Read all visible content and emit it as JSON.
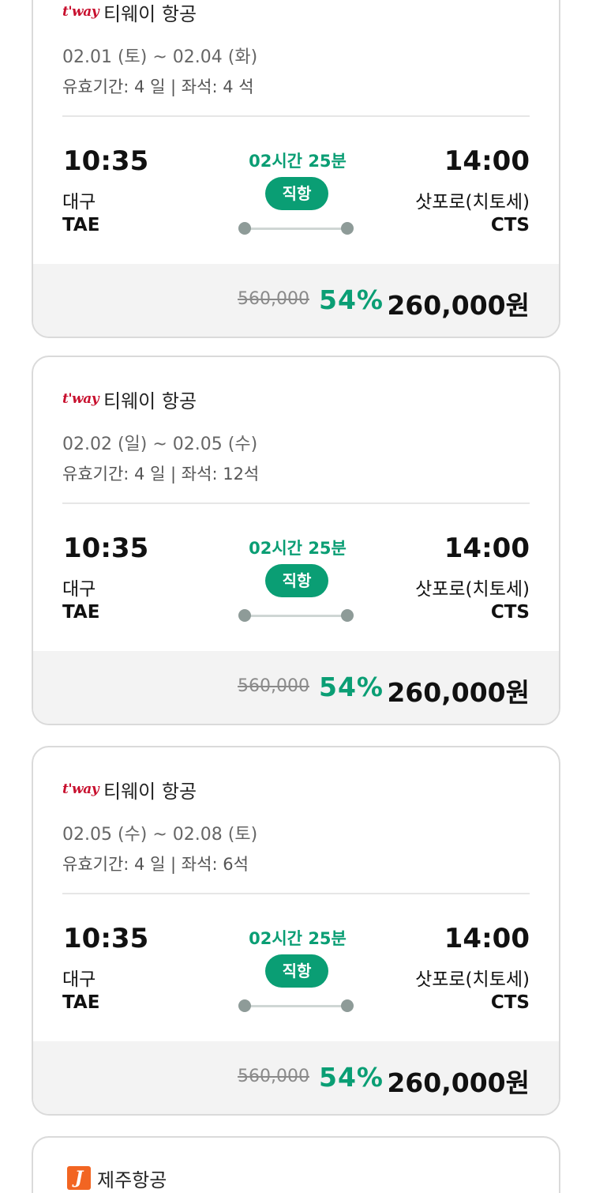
{
  "flights": [
    {
      "airline": "티웨이 항공",
      "logo": "t'way",
      "dates": "02.01 (토) ~ 02.04 (화)",
      "meta": "유효기간: 4 일 | 좌석: 4 석",
      "dep_time": "10:35",
      "dep_city": "대구",
      "dep_code": "TAE",
      "arr_time": "14:00",
      "arr_city": "삿포로(치토세)",
      "arr_code": "CTS",
      "duration": "02시간 25분",
      "type": "직항",
      "orig_price": "560,000",
      "discount": "54%",
      "price": "260,000원"
    },
    {
      "airline": "티웨이 항공",
      "logo": "t'way",
      "dates": "02.02 (일) ~ 02.05 (수)",
      "meta": "유효기간: 4 일 | 좌석: 12석",
      "dep_time": "10:35",
      "dep_city": "대구",
      "dep_code": "TAE",
      "arr_time": "14:00",
      "arr_city": "삿포로(치토세)",
      "arr_code": "CTS",
      "duration": "02시간 25분",
      "type": "직항",
      "orig_price": "560,000",
      "discount": "54%",
      "price": "260,000원"
    },
    {
      "airline": "티웨이 항공",
      "logo": "t'way",
      "dates": "02.05 (수) ~ 02.08 (토)",
      "meta": "유효기간: 4 일 | 좌석: 6석",
      "dep_time": "10:35",
      "dep_city": "대구",
      "dep_code": "TAE",
      "arr_time": "14:00",
      "arr_city": "삿포로(치토세)",
      "arr_code": "CTS",
      "duration": "02시간 25분",
      "type": "직항",
      "orig_price": "560,000",
      "discount": "54%",
      "price": "260,000원"
    }
  ],
  "next_card": {
    "airline": "제주항공",
    "logo": "J"
  },
  "colors": {
    "accent": "#0a9e74",
    "tway_red": "#c8102e",
    "jeju_orange": "#f26522"
  },
  "icons": [
    "tway-logo-icon",
    "jeju-air-logo-icon"
  ]
}
